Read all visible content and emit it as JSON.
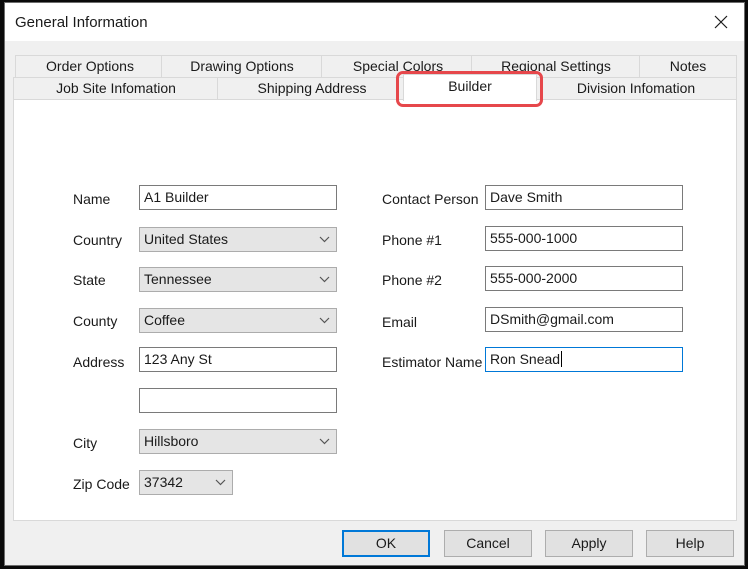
{
  "window": {
    "title": "General Information",
    "close_icon": "close-x-icon"
  },
  "tabs": {
    "row1": [
      {
        "label": "Order Options"
      },
      {
        "label": "Drawing Options"
      },
      {
        "label": "Special Colors"
      },
      {
        "label": "Regional Settings"
      },
      {
        "label": "Notes"
      }
    ],
    "row2": [
      {
        "label": "Job Site Infomation"
      },
      {
        "label": "Shipping Address"
      },
      {
        "label": "Builder",
        "active": true
      },
      {
        "label": "Division Infomation"
      }
    ],
    "highlight_color": "#e6474b"
  },
  "form": {
    "left": {
      "name": {
        "label": "Name",
        "value": "A1 Builder"
      },
      "country": {
        "label": "Country",
        "value": "United States"
      },
      "state": {
        "label": "State",
        "value": "Tennessee"
      },
      "county": {
        "label": "County",
        "value": "Coffee"
      },
      "address": {
        "label": "Address",
        "value": "123 Any St",
        "value2": ""
      },
      "city": {
        "label": "City",
        "value": "Hillsboro"
      },
      "zip": {
        "label": "Zip Code",
        "value": "37342"
      }
    },
    "right": {
      "contact": {
        "label": "Contact Person",
        "value": "Dave Smith"
      },
      "phone1": {
        "label": "Phone #1",
        "value": "555-000-1000"
      },
      "phone2": {
        "label": "Phone #2",
        "value": "555-000-2000"
      },
      "email": {
        "label": "Email",
        "value": "DSmith@gmail.com"
      },
      "estimator": {
        "label": "Estimator Name",
        "value": "Ron Snead"
      }
    }
  },
  "buttons": {
    "ok": "OK",
    "cancel": "Cancel",
    "apply": "Apply",
    "help": "Help"
  }
}
